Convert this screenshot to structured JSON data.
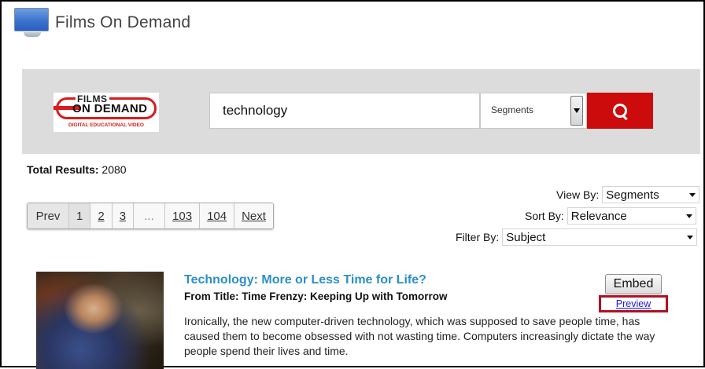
{
  "window": {
    "title": "Films On Demand",
    "icon": "monitor-icon"
  },
  "search": {
    "logo": {
      "films": "FILMS",
      "on_demand": "ON DEMAND",
      "tagline": "DIGITAL EDUCATIONAL VIDEO"
    },
    "query": "technology",
    "scope": "Segments",
    "button_icon": "search-icon",
    "button_color": "#cc0c0c"
  },
  "results": {
    "total_label": "Total Results:",
    "total_value": "2080",
    "pagination": [
      "Prev",
      "1",
      "2",
      "3",
      "...",
      "103",
      "104",
      "Next"
    ],
    "view_by": {
      "label": "View By:",
      "value": "Segments"
    },
    "sort_by": {
      "label": "Sort By:",
      "value": "Relevance"
    },
    "filter_by": {
      "label": "Filter By:",
      "value": "Subject"
    },
    "items": [
      {
        "title": "Technology: More or Less Time for Life?",
        "from_title": "From Title: Time Frenzy: Keeping Up with Tomorrow",
        "description": "Ironically, the new computer-driven technology, which was supposed to save people time, has caused them to become obsessed with not wasting time. Computers increasingly dictate the way people spend their lives and time.",
        "embed_label": "Embed",
        "preview_label": "Preview"
      }
    ]
  },
  "colors": {
    "link": "#2b8fc9",
    "highlight_box": "#b01224",
    "band": "#dcdcdc"
  }
}
